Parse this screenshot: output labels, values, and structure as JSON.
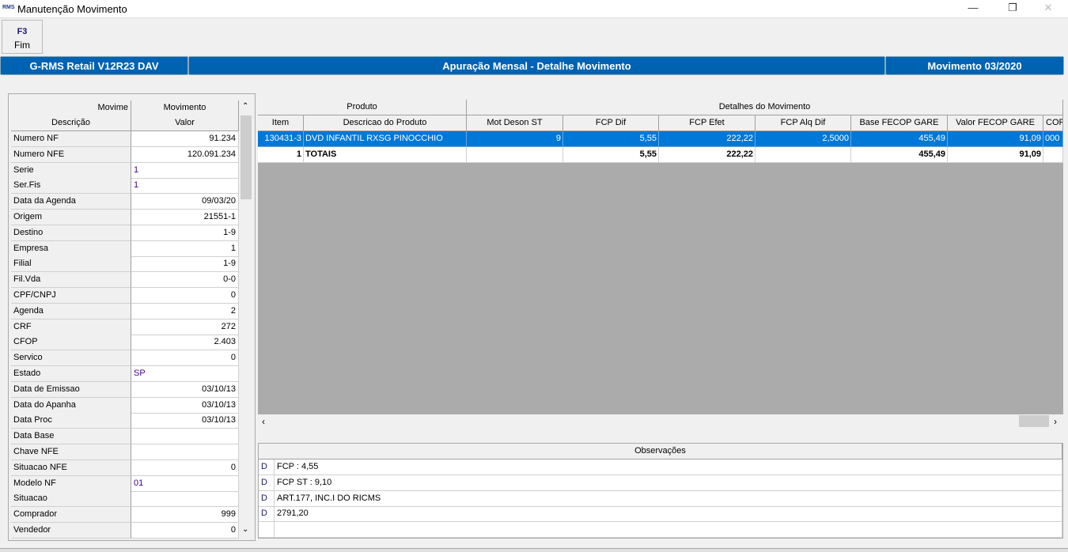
{
  "window": {
    "title": "Manutenção Movimento",
    "logo": "RMS",
    "minimize": "—",
    "restore": "❐",
    "close": "✕"
  },
  "toolbar": {
    "key": "F3",
    "label": "Fim"
  },
  "header": {
    "app": "G-RMS Retail V12R23 DAV",
    "title": "Apuração Mensal - Detalhe Movimento",
    "period": "Movimento 03/2020"
  },
  "left": {
    "group_header_left": "Movime",
    "group_header": "Movimento",
    "col_desc": "Descrição",
    "col_val": "Valor",
    "rows": [
      {
        "label": "Numero NF",
        "value": "91.234",
        "align": "right"
      },
      {
        "label": "Numero NFE",
        "value": "120.091.234",
        "align": "right"
      },
      {
        "label": "Serie",
        "value": "1",
        "align": "left"
      },
      {
        "label": "Ser.Fis",
        "value": "1",
        "align": "left"
      },
      {
        "label": "Data da Agenda",
        "value": "09/03/20",
        "align": "right"
      },
      {
        "label": "Origem",
        "value": "21551-1",
        "align": "right"
      },
      {
        "label": "Destino",
        "value": "1-9",
        "align": "right"
      },
      {
        "label": "Empresa",
        "value": "1",
        "align": "right"
      },
      {
        "label": "Filial",
        "value": "1-9",
        "align": "right"
      },
      {
        "label": "Fil.Vda",
        "value": "0-0",
        "align": "right"
      },
      {
        "label": "CPF/CNPJ",
        "value": "0",
        "align": "right"
      },
      {
        "label": "Agenda",
        "value": "2",
        "align": "right"
      },
      {
        "label": "CRF",
        "value": "272",
        "align": "right"
      },
      {
        "label": "CFOP",
        "value": "2.403",
        "align": "right"
      },
      {
        "label": "Servico",
        "value": "0",
        "align": "right"
      },
      {
        "label": "Estado",
        "value": "SP",
        "align": "left"
      },
      {
        "label": "Data de Emissao",
        "value": "03/10/13",
        "align": "right"
      },
      {
        "label": "Data do Apanha",
        "value": "03/10/13",
        "align": "right"
      },
      {
        "label": "Data Proc",
        "value": "03/10/13",
        "align": "right"
      },
      {
        "label": "Data Base",
        "value": "",
        "align": "right"
      },
      {
        "label": "Chave NFE",
        "value": "",
        "align": "right"
      },
      {
        "label": "Situacao NFE",
        "value": "0",
        "align": "right"
      },
      {
        "label": "Modelo NF",
        "value": "01",
        "align": "left"
      },
      {
        "label": "Situacao",
        "value": "",
        "align": "right"
      },
      {
        "label": "Comprador",
        "value": "999",
        "align": "right"
      },
      {
        "label": "Vendedor",
        "value": "0",
        "align": "right"
      }
    ]
  },
  "detail": {
    "group_produto": "Produto",
    "group_detalhes": "Detalhes do Movimento",
    "columns": [
      "Item",
      "Descricao do Produto",
      "Mot Deson ST",
      "FCP Dif",
      "FCP Efet",
      "FCP Alq Dif",
      "Base FECOP GARE",
      "Valor FECOP GARE",
      "COF"
    ],
    "rows": [
      {
        "selected": true,
        "cells": [
          "130431-3",
          "DVD INFANTIL RXSG PINOCCHIO",
          "9",
          "5,55",
          "222,22",
          "2,5000",
          "455,49",
          "91,09",
          "000"
        ]
      },
      {
        "selected": false,
        "cells": [
          "1",
          "TOTAIS",
          "",
          "5,55",
          "222,22",
          "",
          "455,49",
          "91,09",
          ""
        ]
      }
    ]
  },
  "observacoes": {
    "header": "Observações",
    "rows": [
      {
        "type": "D",
        "text": "FCP : 4,55"
      },
      {
        "type": "D",
        "text": "FCP ST : 9,10"
      },
      {
        "type": "D",
        "text": "ART.177, INC.I DO RICMS"
      },
      {
        "type": "D",
        "text": "2791,20"
      },
      {
        "type": "",
        "text": ""
      }
    ]
  },
  "colors": {
    "accent": "#0063b1",
    "selection": "#0078d7",
    "empty_area": "#ababab"
  }
}
